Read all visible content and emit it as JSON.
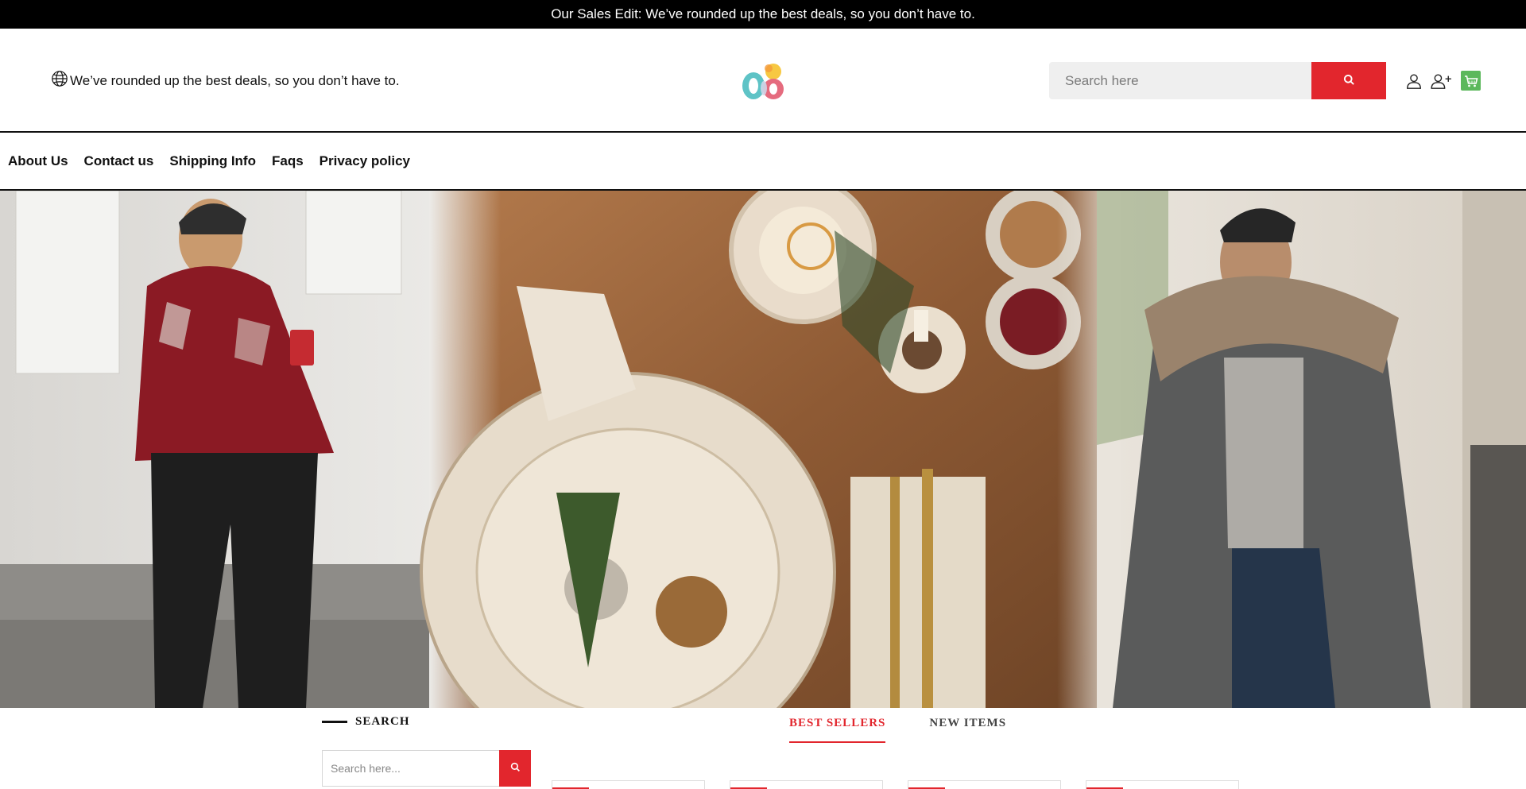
{
  "announcement": {
    "text": "Our Sales Edit: We’ve rounded up the best deals, so you don’t have to."
  },
  "header": {
    "tagline": "We’ve rounded up the best deals, so you don’t have to.",
    "search_placeholder": "Search here",
    "icons": [
      "globe-icon",
      "search-icon",
      "user-icon",
      "add-user-icon",
      "cart-icon"
    ],
    "colors": {
      "accent": "#e2262d",
      "cart": "#5cb85c",
      "logo_teal": "#5ec3c6",
      "logo_pink": "#e56b7e",
      "logo_yellow": "#f7c842"
    }
  },
  "nav": {
    "items": [
      "About Us",
      "Contact us",
      "Shipping Info",
      "Faqs",
      "Privacy policy"
    ]
  },
  "sidebar": {
    "title": "SEARCH",
    "search_placeholder": "Search here..."
  },
  "tabs": {
    "items": [
      "BEST SELLERS",
      "NEW ITEMS"
    ],
    "active": "BEST SELLERS"
  }
}
